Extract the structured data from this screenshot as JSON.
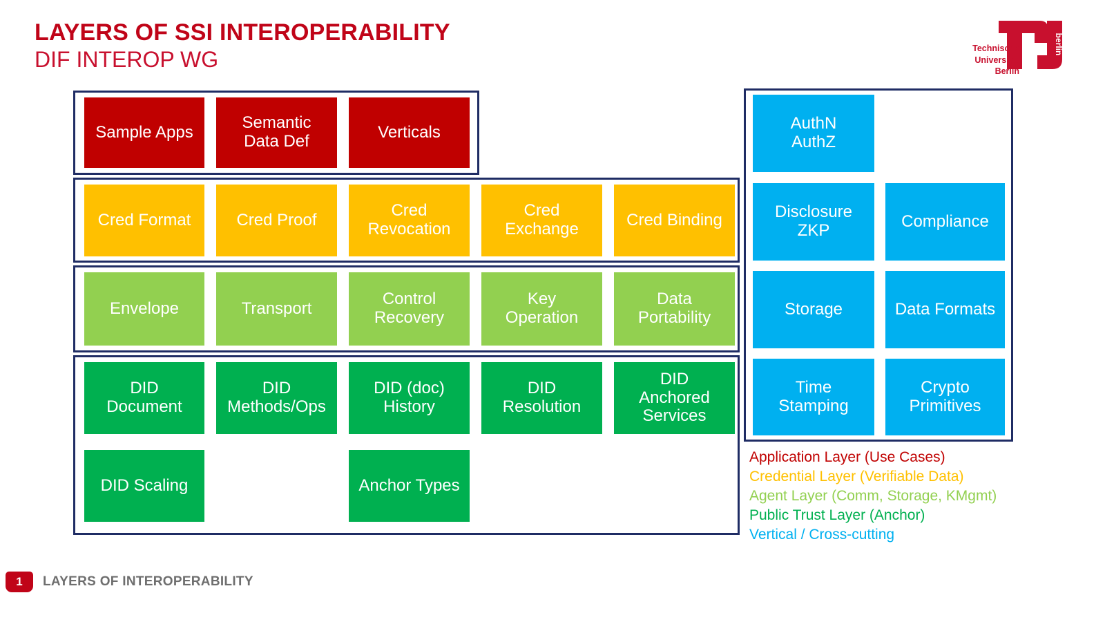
{
  "header": {
    "title": "LAYERS OF SSI INTEROPERABILITY",
    "subtitle": "DIF INTEROP WG"
  },
  "logo": {
    "line1": "Technische",
    "line2": "Universität",
    "line3": "Berlin",
    "mark_label": "berlin",
    "color": "#C8102E"
  },
  "colors": {
    "application": "#C00000",
    "credential": "#FFC000",
    "agent": "#92D050",
    "public_trust": "#00B050",
    "vertical": "#00B0F0",
    "frame": "#1F2C64",
    "title": "#C00418",
    "footer_text": "#6E6E6E"
  },
  "layers": {
    "application": {
      "name": "Application Layer",
      "cells": [
        "Sample Apps",
        "Semantic\nData Def",
        "Verticals"
      ]
    },
    "credential": {
      "name": "Credential Layer",
      "cells": [
        "Cred Format",
        "Cred Proof",
        "Cred\nRevocation",
        "Cred\nExchange",
        "Cred Binding"
      ]
    },
    "agent": {
      "name": "Agent Layer",
      "cells": [
        "Envelope",
        "Transport",
        "Control\nRecovery",
        "Key\nOperation",
        "Data\nPortability"
      ]
    },
    "public_trust": {
      "name": "Public Trust Layer",
      "row1": [
        "DID\nDocument",
        "DID\nMethods/Ops",
        "DID (doc)\nHistory",
        "DID\nResolution",
        "DID\nAnchored\nServices"
      ],
      "row2": [
        "DID Scaling",
        "Anchor Types"
      ]
    },
    "vertical": {
      "name": "Vertical / Cross-cutting",
      "rows": [
        [
          "AuthN\nAuthZ",
          ""
        ],
        [
          "Disclosure\nZKP",
          "Compliance"
        ],
        [
          "Storage",
          "Data Formats"
        ],
        [
          "Time\nStamping",
          "Crypto\nPrimitives"
        ]
      ]
    }
  },
  "legend": [
    {
      "text": "Application Layer (Use Cases)",
      "color": "#C00000"
    },
    {
      "text": "Credential Layer (Verifiable Data)",
      "color": "#FFC000"
    },
    {
      "text": "Agent Layer (Comm, Storage, KMgmt)",
      "color": "#92D050"
    },
    {
      "text": "Public Trust Layer (Anchor)",
      "color": "#00B050"
    },
    {
      "text": "Vertical / Cross-cutting",
      "color": "#00B0F0"
    }
  ],
  "footer": {
    "page_number": "1",
    "label": "LAYERS OF INTEROPERABILITY"
  }
}
